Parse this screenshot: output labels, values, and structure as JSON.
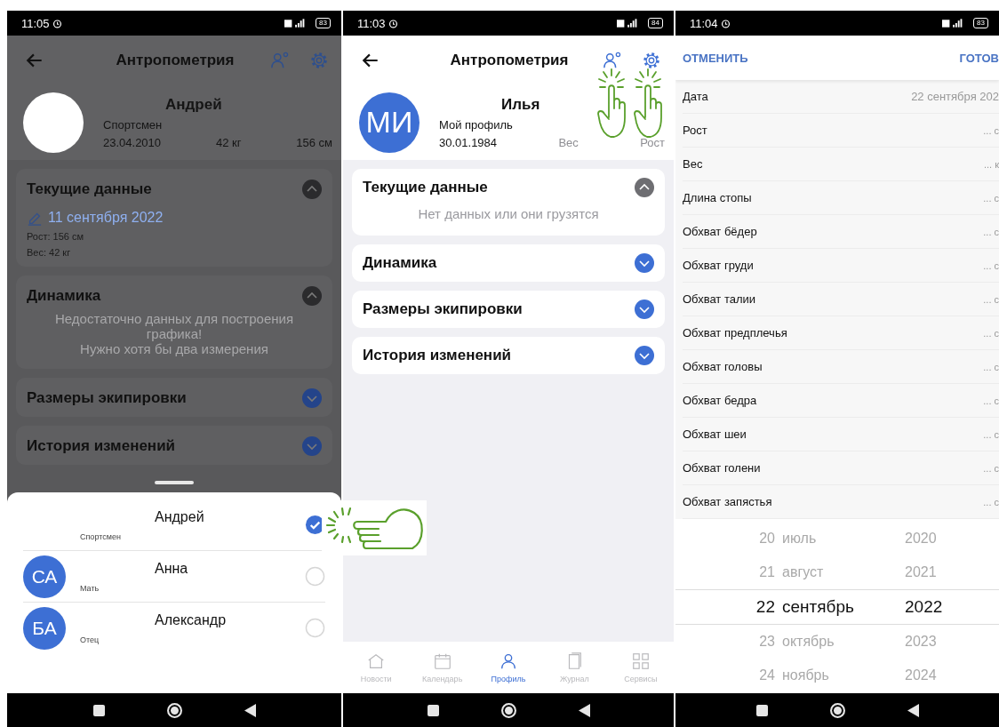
{
  "athlete_screen": {
    "status_bar": {
      "time": "11:05",
      "battery": "83"
    },
    "header": {
      "title": "Антропометрия"
    },
    "profile": {
      "name": "Андрей",
      "role": "Спортсмен",
      "birth_date": "23.04.2010",
      "weight": "42 кг",
      "height": "156 см"
    },
    "sections": [
      {
        "title": "Текущие данные",
        "expanded": true,
        "date": "11 сентября 2022",
        "lines": [
          "Рост: 156 см",
          "Вес: 42 кг"
        ]
      },
      {
        "title": "Динамика",
        "expanded": true,
        "message": "Недостаточно данных для построения графика!\nНужно хотя бы два измерения"
      },
      {
        "title": "Размеры экипировки",
        "expanded": false
      },
      {
        "title": "История изменений",
        "expanded": false
      }
    ],
    "profile_sheet": {
      "people": [
        {
          "name": "Андрей",
          "role": "Спортсмен",
          "selected": true
        },
        {
          "initials": "СА",
          "name": "Анна",
          "role": "Мать",
          "selected": false
        },
        {
          "initials": "БА",
          "name": "Александр",
          "role": "Отец",
          "selected": false
        }
      ]
    }
  },
  "own_profile_screen": {
    "status_bar": {
      "time": "11:03",
      "battery": "84"
    },
    "header": {
      "title": "Антропометрия"
    },
    "profile": {
      "initials": "МИ",
      "name": "Илья",
      "role": "Мой профиль",
      "birth_date": "30.01.1984",
      "weight": "Вес",
      "height": "Рост"
    },
    "sections": [
      {
        "title": "Текущие данные",
        "expanded": true,
        "message": "Нет данных или они грузятся"
      },
      {
        "title": "Динамика",
        "expanded": false
      },
      {
        "title": "Размеры экипировки",
        "expanded": false
      },
      {
        "title": "История изменений",
        "expanded": false
      }
    ],
    "tab_bar": [
      {
        "label": "Новости",
        "selected": false
      },
      {
        "label": "Календарь",
        "selected": false
      },
      {
        "label": "Профиль",
        "selected": true
      },
      {
        "label": "Журнал",
        "selected": false
      },
      {
        "label": "Сервисы",
        "selected": false
      }
    ]
  },
  "measurement_form": {
    "status_bar": {
      "time": "11:04",
      "battery": "83"
    },
    "cancel": "ОТМЕНИТЬ",
    "done": "ГОТОВ",
    "fields": [
      {
        "label": "Дата",
        "value": "22 сентября 202"
      },
      {
        "label": "Рост",
        "value": "... с"
      },
      {
        "label": "Вес",
        "value": "... к"
      },
      {
        "label": "Длина стопы",
        "value": "... с"
      },
      {
        "label": "Обхват бёдер",
        "value": "... с"
      },
      {
        "label": "Обхват груди",
        "value": "... с"
      },
      {
        "label": "Обхват талии",
        "value": "... с"
      },
      {
        "label": "Обхват предплечья",
        "value": "... с"
      },
      {
        "label": "Обхват головы",
        "value": "... с"
      },
      {
        "label": "Обхват бедра",
        "value": "... с"
      },
      {
        "label": "Обхват шеи",
        "value": "... с"
      },
      {
        "label": "Обхват голени",
        "value": "... с"
      },
      {
        "label": "Обхват запястья",
        "value": "... с"
      }
    ],
    "date_picker": [
      {
        "day": "20",
        "month": "июль",
        "year": "2020",
        "selected": false
      },
      {
        "day": "21",
        "month": "август",
        "year": "2021",
        "selected": false
      },
      {
        "day": "22",
        "month": "сентябрь",
        "year": "2022",
        "selected": true
      },
      {
        "day": "23",
        "month": "октябрь",
        "year": "2023",
        "selected": false
      },
      {
        "day": "24",
        "month": "ноябрь",
        "year": "2024",
        "selected": false
      }
    ]
  }
}
